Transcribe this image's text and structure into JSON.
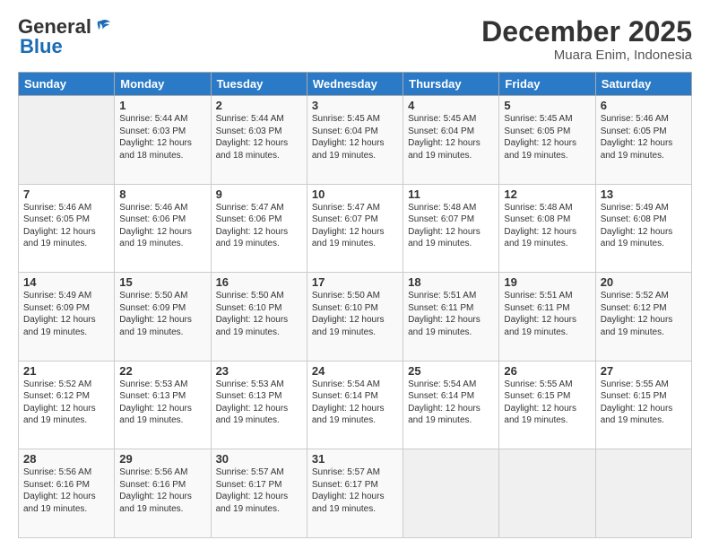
{
  "header": {
    "logo_general": "General",
    "logo_blue": "Blue",
    "title": "December 2025",
    "subtitle": "Muara Enim, Indonesia"
  },
  "calendar": {
    "days_of_week": [
      "Sunday",
      "Monday",
      "Tuesday",
      "Wednesday",
      "Thursday",
      "Friday",
      "Saturday"
    ],
    "weeks": [
      [
        {
          "day": "",
          "sunrise": "",
          "sunset": "",
          "daylight": "",
          "empty": true
        },
        {
          "day": "1",
          "sunrise": "Sunrise: 5:44 AM",
          "sunset": "Sunset: 6:03 PM",
          "daylight": "Daylight: 12 hours and 18 minutes."
        },
        {
          "day": "2",
          "sunrise": "Sunrise: 5:44 AM",
          "sunset": "Sunset: 6:03 PM",
          "daylight": "Daylight: 12 hours and 18 minutes."
        },
        {
          "day": "3",
          "sunrise": "Sunrise: 5:45 AM",
          "sunset": "Sunset: 6:04 PM",
          "daylight": "Daylight: 12 hours and 19 minutes."
        },
        {
          "day": "4",
          "sunrise": "Sunrise: 5:45 AM",
          "sunset": "Sunset: 6:04 PM",
          "daylight": "Daylight: 12 hours and 19 minutes."
        },
        {
          "day": "5",
          "sunrise": "Sunrise: 5:45 AM",
          "sunset": "Sunset: 6:05 PM",
          "daylight": "Daylight: 12 hours and 19 minutes."
        },
        {
          "day": "6",
          "sunrise": "Sunrise: 5:46 AM",
          "sunset": "Sunset: 6:05 PM",
          "daylight": "Daylight: 12 hours and 19 minutes."
        }
      ],
      [
        {
          "day": "7",
          "sunrise": "Sunrise: 5:46 AM",
          "sunset": "Sunset: 6:05 PM",
          "daylight": "Daylight: 12 hours and 19 minutes."
        },
        {
          "day": "8",
          "sunrise": "Sunrise: 5:46 AM",
          "sunset": "Sunset: 6:06 PM",
          "daylight": "Daylight: 12 hours and 19 minutes."
        },
        {
          "day": "9",
          "sunrise": "Sunrise: 5:47 AM",
          "sunset": "Sunset: 6:06 PM",
          "daylight": "Daylight: 12 hours and 19 minutes."
        },
        {
          "day": "10",
          "sunrise": "Sunrise: 5:47 AM",
          "sunset": "Sunset: 6:07 PM",
          "daylight": "Daylight: 12 hours and 19 minutes."
        },
        {
          "day": "11",
          "sunrise": "Sunrise: 5:48 AM",
          "sunset": "Sunset: 6:07 PM",
          "daylight": "Daylight: 12 hours and 19 minutes."
        },
        {
          "day": "12",
          "sunrise": "Sunrise: 5:48 AM",
          "sunset": "Sunset: 6:08 PM",
          "daylight": "Daylight: 12 hours and 19 minutes."
        },
        {
          "day": "13",
          "sunrise": "Sunrise: 5:49 AM",
          "sunset": "Sunset: 6:08 PM",
          "daylight": "Daylight: 12 hours and 19 minutes."
        }
      ],
      [
        {
          "day": "14",
          "sunrise": "Sunrise: 5:49 AM",
          "sunset": "Sunset: 6:09 PM",
          "daylight": "Daylight: 12 hours and 19 minutes."
        },
        {
          "day": "15",
          "sunrise": "Sunrise: 5:50 AM",
          "sunset": "Sunset: 6:09 PM",
          "daylight": "Daylight: 12 hours and 19 minutes."
        },
        {
          "day": "16",
          "sunrise": "Sunrise: 5:50 AM",
          "sunset": "Sunset: 6:10 PM",
          "daylight": "Daylight: 12 hours and 19 minutes."
        },
        {
          "day": "17",
          "sunrise": "Sunrise: 5:50 AM",
          "sunset": "Sunset: 6:10 PM",
          "daylight": "Daylight: 12 hours and 19 minutes."
        },
        {
          "day": "18",
          "sunrise": "Sunrise: 5:51 AM",
          "sunset": "Sunset: 6:11 PM",
          "daylight": "Daylight: 12 hours and 19 minutes."
        },
        {
          "day": "19",
          "sunrise": "Sunrise: 5:51 AM",
          "sunset": "Sunset: 6:11 PM",
          "daylight": "Daylight: 12 hours and 19 minutes."
        },
        {
          "day": "20",
          "sunrise": "Sunrise: 5:52 AM",
          "sunset": "Sunset: 6:12 PM",
          "daylight": "Daylight: 12 hours and 19 minutes."
        }
      ],
      [
        {
          "day": "21",
          "sunrise": "Sunrise: 5:52 AM",
          "sunset": "Sunset: 6:12 PM",
          "daylight": "Daylight: 12 hours and 19 minutes."
        },
        {
          "day": "22",
          "sunrise": "Sunrise: 5:53 AM",
          "sunset": "Sunset: 6:13 PM",
          "daylight": "Daylight: 12 hours and 19 minutes."
        },
        {
          "day": "23",
          "sunrise": "Sunrise: 5:53 AM",
          "sunset": "Sunset: 6:13 PM",
          "daylight": "Daylight: 12 hours and 19 minutes."
        },
        {
          "day": "24",
          "sunrise": "Sunrise: 5:54 AM",
          "sunset": "Sunset: 6:14 PM",
          "daylight": "Daylight: 12 hours and 19 minutes."
        },
        {
          "day": "25",
          "sunrise": "Sunrise: 5:54 AM",
          "sunset": "Sunset: 6:14 PM",
          "daylight": "Daylight: 12 hours and 19 minutes."
        },
        {
          "day": "26",
          "sunrise": "Sunrise: 5:55 AM",
          "sunset": "Sunset: 6:15 PM",
          "daylight": "Daylight: 12 hours and 19 minutes."
        },
        {
          "day": "27",
          "sunrise": "Sunrise: 5:55 AM",
          "sunset": "Sunset: 6:15 PM",
          "daylight": "Daylight: 12 hours and 19 minutes."
        }
      ],
      [
        {
          "day": "28",
          "sunrise": "Sunrise: 5:56 AM",
          "sunset": "Sunset: 6:16 PM",
          "daylight": "Daylight: 12 hours and 19 minutes."
        },
        {
          "day": "29",
          "sunrise": "Sunrise: 5:56 AM",
          "sunset": "Sunset: 6:16 PM",
          "daylight": "Daylight: 12 hours and 19 minutes."
        },
        {
          "day": "30",
          "sunrise": "Sunrise: 5:57 AM",
          "sunset": "Sunset: 6:17 PM",
          "daylight": "Daylight: 12 hours and 19 minutes."
        },
        {
          "day": "31",
          "sunrise": "Sunrise: 5:57 AM",
          "sunset": "Sunset: 6:17 PM",
          "daylight": "Daylight: 12 hours and 19 minutes."
        },
        {
          "day": "",
          "sunrise": "",
          "sunset": "",
          "daylight": "",
          "empty": true
        },
        {
          "day": "",
          "sunrise": "",
          "sunset": "",
          "daylight": "",
          "empty": true
        },
        {
          "day": "",
          "sunrise": "",
          "sunset": "",
          "daylight": "",
          "empty": true
        }
      ]
    ]
  }
}
